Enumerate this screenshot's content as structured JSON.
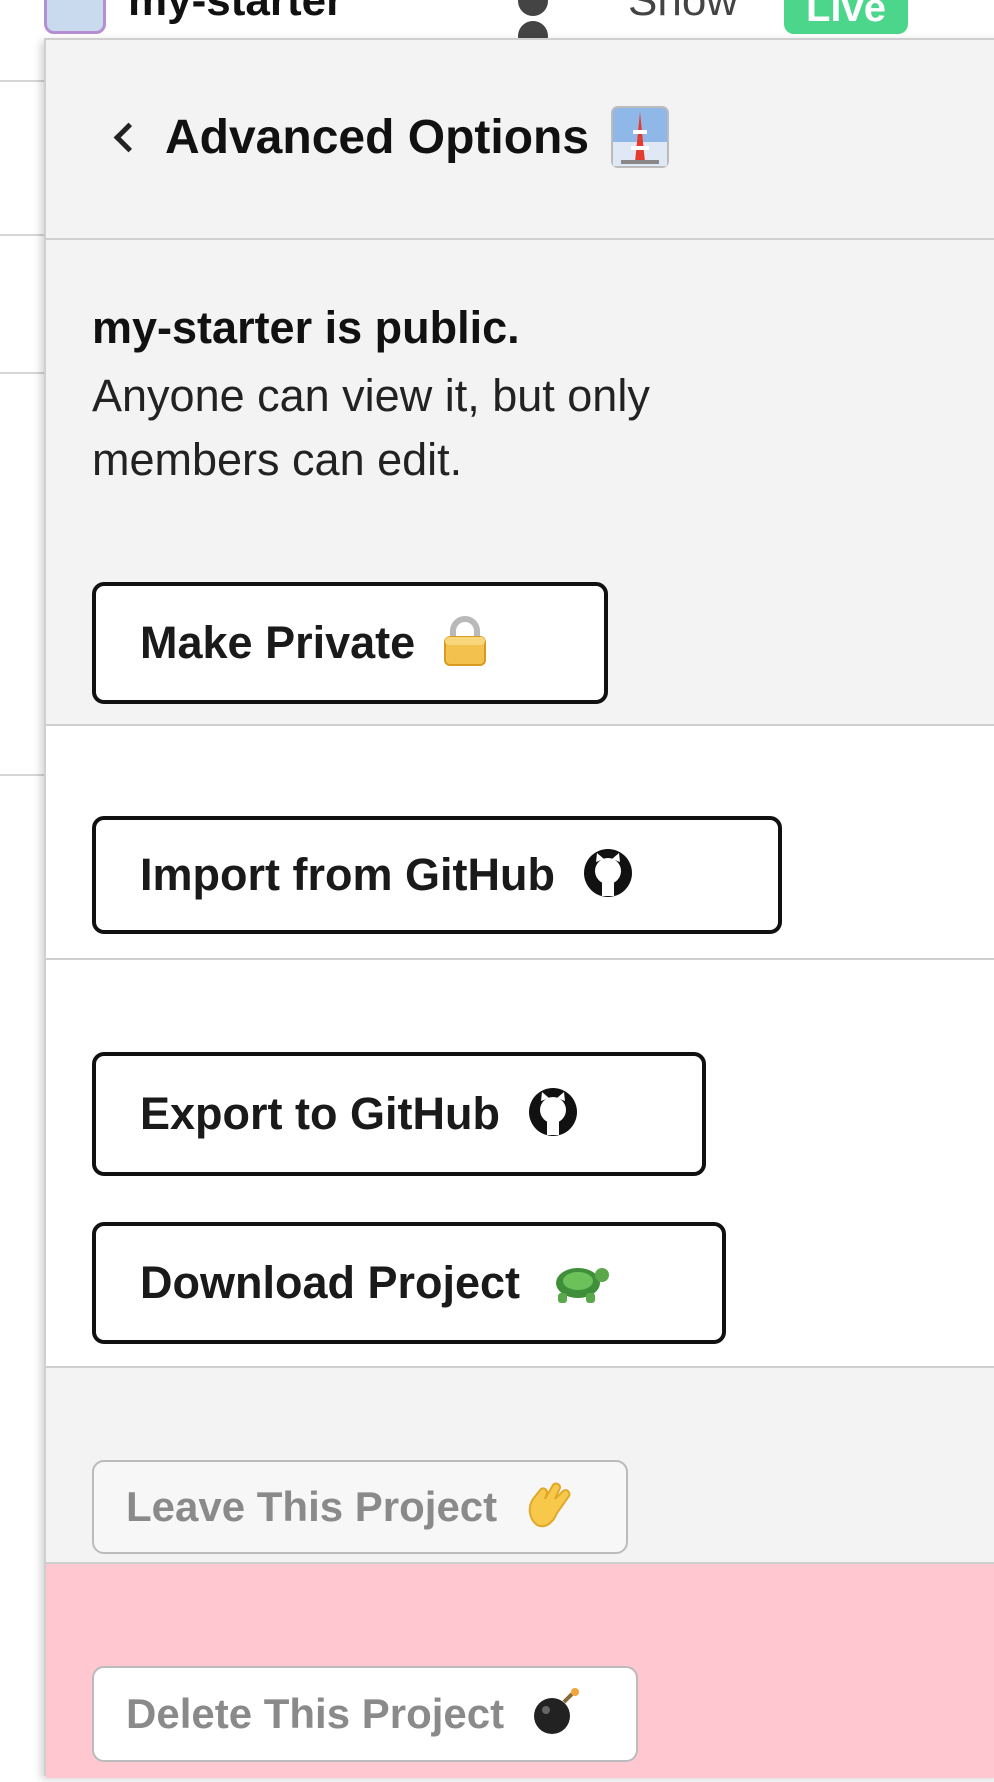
{
  "topbar": {
    "project_name": "my-starter",
    "show_label": "Show",
    "live_badge": "Live"
  },
  "popover": {
    "header": {
      "title": "Advanced Options",
      "icon": "tokyo-tower-icon"
    },
    "visibility": {
      "status": "my-starter is public.",
      "description": "Anyone can view it, but only members can edit.",
      "make_private_label": "Make Private",
      "make_private_icon": "lock-icon"
    },
    "import": {
      "label": "Import from GitHub",
      "icon": "github-icon"
    },
    "export": {
      "export_label": "Export to GitHub",
      "export_icon": "github-icon",
      "download_label": "Download Project",
      "download_icon": "turtle-icon"
    },
    "leave": {
      "label": "Leave This Project",
      "icon": "waving-hand-icon"
    },
    "delete": {
      "label": "Delete This Project",
      "icon": "bomb-icon"
    }
  },
  "colors": {
    "popover_bg": "#f3f3f3",
    "danger_bg": "#ffc8d0",
    "live_green": "#4cd68b",
    "border": "#cfcfcf"
  }
}
